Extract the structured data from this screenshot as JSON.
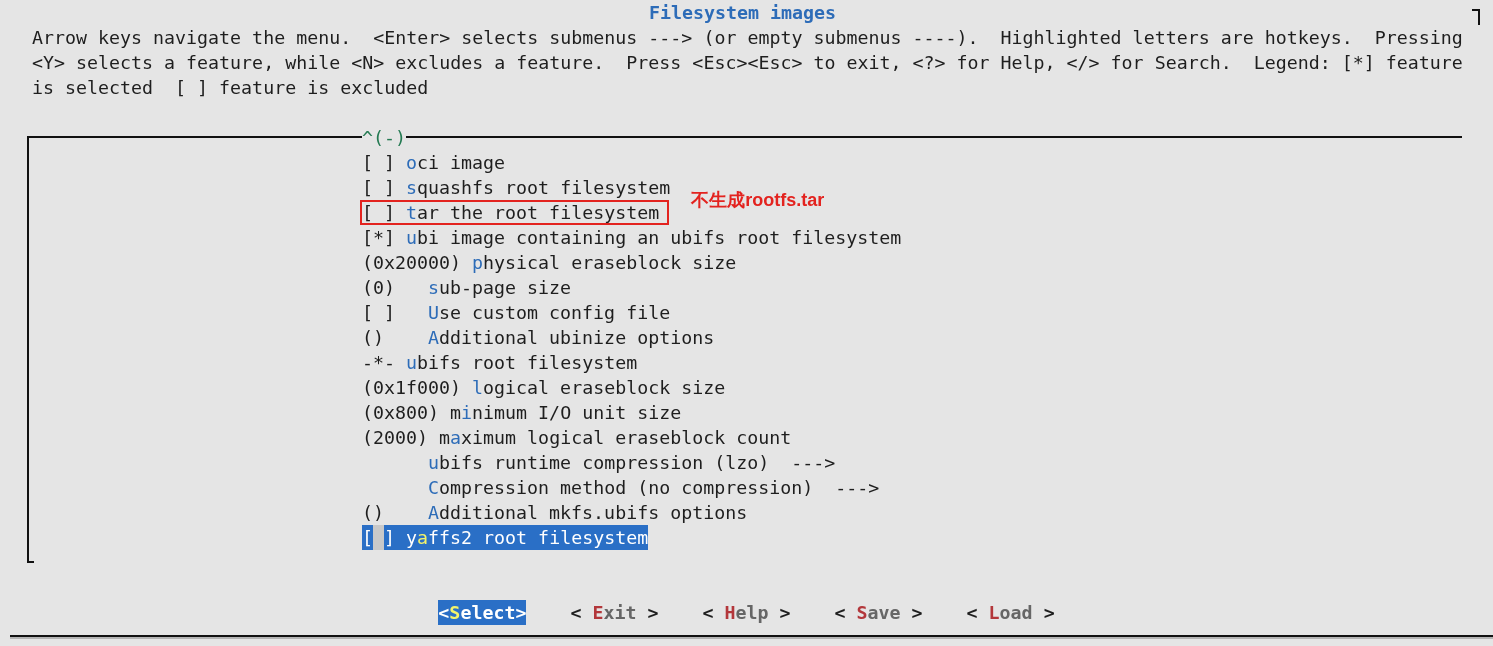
{
  "title": "Filesystem images",
  "help_text": "Arrow keys navigate the menu.  <Enter> selects submenus ---> (or empty submenus ----).  Highlighted letters are hotkeys.  Pressing <Y> selects a feature, while <N> excludes a feature.  Press <Esc><Esc> to exit, <?> for Help, </> for Search.  Legend: [*] feature is selected  [ ] feature is excluded",
  "menu": {
    "scroll_indicator": "^(-)",
    "items": [
      {
        "prefix": "[ ]",
        "hotkey": "o",
        "label_rest": "ci image",
        "selected": false
      },
      {
        "prefix": "[ ]",
        "hotkey": "s",
        "label_rest": "quashfs root filesystem",
        "selected": false
      },
      {
        "prefix": "[ ]",
        "hotkey": "t",
        "label_rest": "ar the root filesystem",
        "selected": false,
        "annotation": {
          "text": "不生成rootfs.tar"
        }
      },
      {
        "prefix": "[*]",
        "hotkey": "u",
        "label_rest": "bi image containing an ubifs root filesystem",
        "selected": false,
        "children": [
          {
            "prefix": "(0x20000)",
            "hotkey": "p",
            "label_rest": "hysical eraseblock size",
            "selected": false
          },
          {
            "prefix": "(0)",
            "hotkey": "s",
            "label_rest": "ub-page size",
            "selected": false
          },
          {
            "prefix": "[ ]",
            "hotkey": "U",
            "label_rest": "se custom config file",
            "selected": false
          },
          {
            "prefix": "()",
            "hotkey": "A",
            "label_rest": "dditional ubinize options",
            "selected": false
          }
        ]
      },
      {
        "prefix": "-*-",
        "hotkey": "u",
        "label_rest": "bifs root filesystem",
        "selected": false,
        "children": [
          {
            "prefix": "(0x1f000)",
            "hotkey": "l",
            "label_rest": "ogical eraseblock size",
            "selected": false
          },
          {
            "prefix": "(0x800)",
            "label_start": "m",
            "hotkey": "i",
            "label_rest": "nimum I/O unit size",
            "selected": false
          },
          {
            "prefix": "(2000)",
            "label_start": "m",
            "hotkey": "a",
            "label_rest": "ximum logical eraseblock count",
            "selected": false
          },
          {
            "hotkey": "u",
            "label_rest": "bifs runtime compression (lzo)",
            "submenu_arrow": "--->",
            "selected": false
          },
          {
            "hotkey": "C",
            "label_rest": "ompression method (no compression)",
            "submenu_arrow": "--->",
            "selected": false
          },
          {
            "prefix": "()",
            "hotkey": "A",
            "label_rest": "dditional mkfs.ubifs options",
            "selected": false
          }
        ]
      },
      {
        "prefix": "[ ]",
        "label_start": "y",
        "hotkey": "a",
        "label_rest": "ffs2 root filesystem",
        "selected": true
      }
    ]
  },
  "buttons": [
    {
      "left": "<",
      "hotkey": "S",
      "label_rest": "elect",
      "right": ">",
      "selected": true
    },
    {
      "left": "<",
      "hotkey": "E",
      "label_rest": "xit",
      "right": ">",
      "selected": false
    },
    {
      "left": "<",
      "hotkey": "H",
      "label_rest": "elp",
      "right": ">",
      "selected": false
    },
    {
      "left": "<",
      "hotkey": "S",
      "label_rest": "ave",
      "right": ">",
      "selected": false
    },
    {
      "left": "<",
      "hotkey": "L",
      "label_rest": "oad",
      "right": ">",
      "selected": false
    }
  ]
}
